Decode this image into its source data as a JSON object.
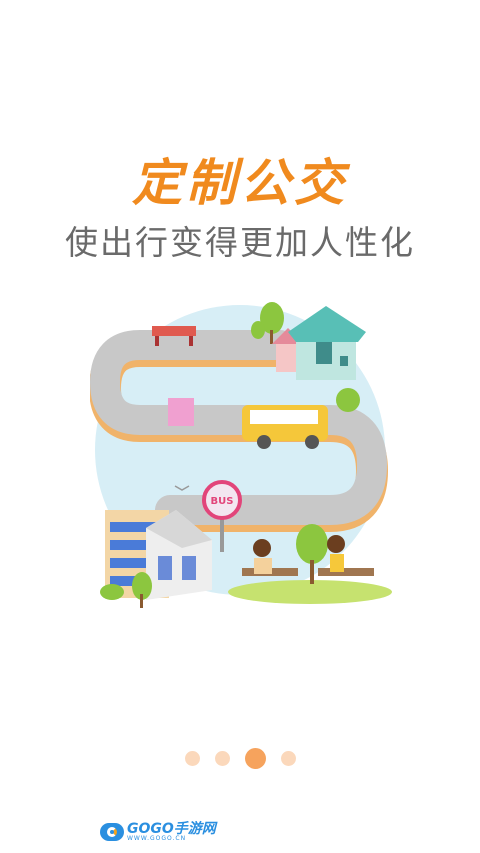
{
  "onboarding": {
    "title": "定制公交",
    "subtitle": "使出行变得更加人性化",
    "illustration": {
      "bus_sign": "BUS"
    },
    "pager": {
      "page_count": 4,
      "current_page": 3
    }
  },
  "watermark": {
    "brand": "GOGO手游网",
    "url": "WWW.GOGO.CN"
  },
  "colors": {
    "accent": "#f08a1e",
    "subtitle": "#6a6a6a",
    "dot_active": "#f6a35d",
    "dot_inactive": "#fbd8bb"
  }
}
